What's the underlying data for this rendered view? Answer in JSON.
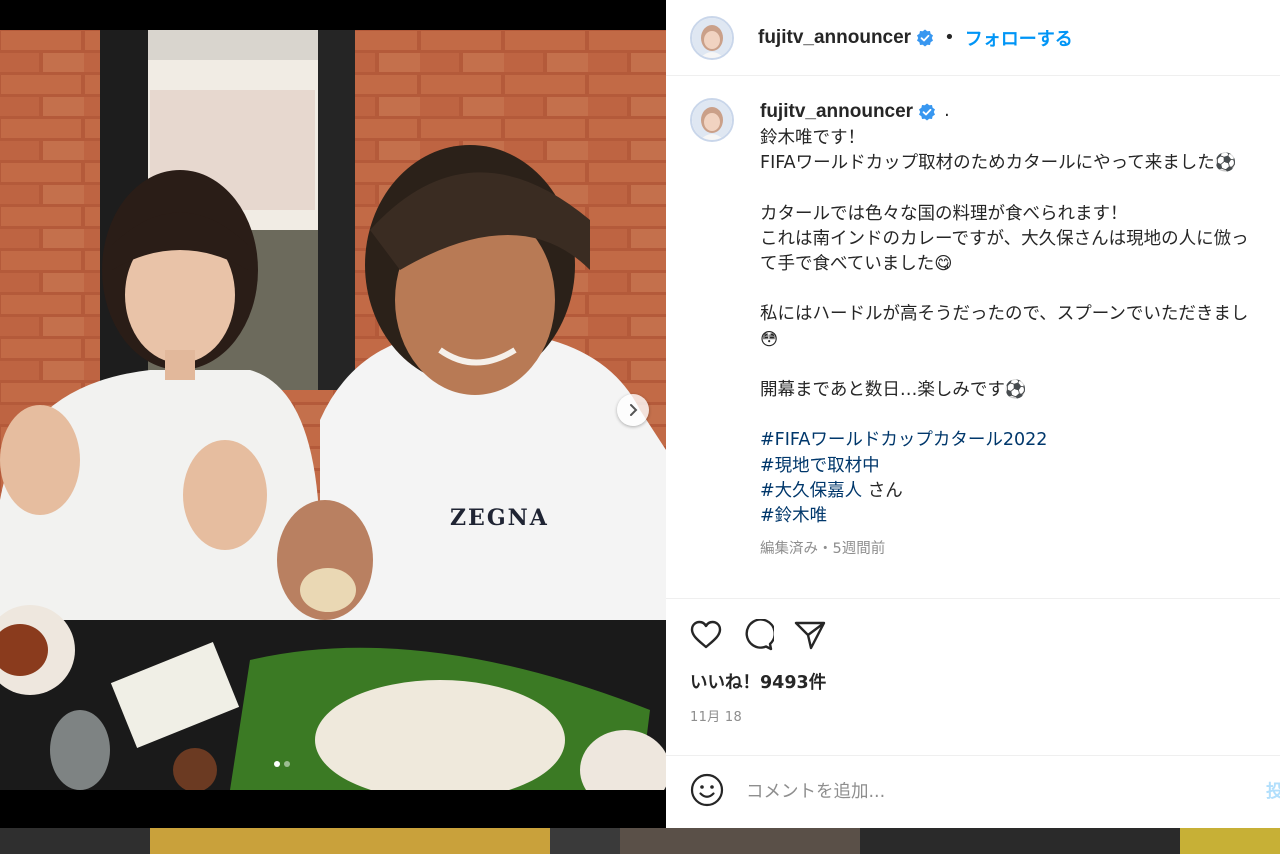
{
  "header": {
    "username": "fujitv_announcer",
    "separator": "•",
    "follow_label": "フォローする"
  },
  "post": {
    "username": "fujitv_announcer",
    "caption_suffix": ".",
    "caption_lines": [
      "鈴木唯です！",
      "FIFAワールドカップ取材のためカタールにやって来ました⚽",
      "",
      "カタールでは色々な国の料理が食べられます！",
      "これは南インドのカレーですが、大久保さんは現地の人に倣っ",
      "て手で食べていました😋",
      "",
      "私にはハードルが高そうだったので、スプーンでいただきまし",
      "😳",
      "",
      "開幕まであと数日…楽しみです⚽",
      ""
    ],
    "hashtags": [
      {
        "tag": "#FIFAワールドカップカタール2022",
        "suffix": ""
      },
      {
        "tag": "#現地で取材中",
        "suffix": ""
      },
      {
        "tag": "#大久保嘉人",
        "suffix": " さん"
      },
      {
        "tag": "#鈴木唯",
        "suffix": ""
      }
    ],
    "meta": "編集済み・5週間前"
  },
  "engagement": {
    "likes": "いいね！9493件",
    "date": "11月 18"
  },
  "comment_box": {
    "placeholder": "コメントを追加...",
    "post_label": "投稿する"
  },
  "photo": {
    "shirt_print": "ZEGNA",
    "carousel_total": 2,
    "carousel_active": 1
  },
  "colors": {
    "accent": "#0095f6",
    "hashtag": "#00376b",
    "verified": "#3897f0",
    "muted": "#8e8e8e"
  }
}
